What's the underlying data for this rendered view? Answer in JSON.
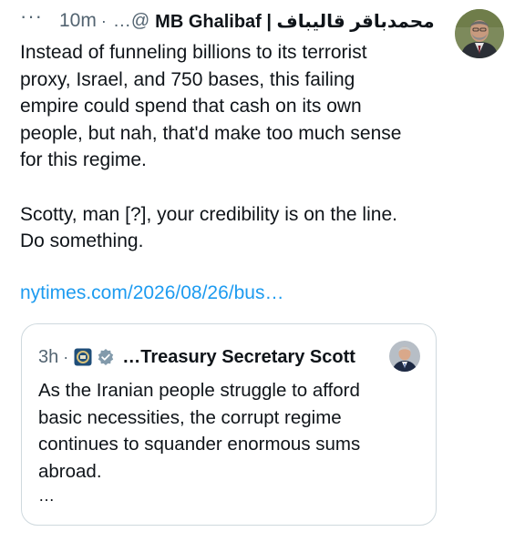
{
  "tweet": {
    "more_label": "···",
    "time": "10m",
    "separator": "·",
    "handle": "…@",
    "display_name": "MB Ghalibaf | محمدباقر قالیباف",
    "body_lines": [
      "Instead of funneling billions to its terrorist",
      "proxy, Israel, and 750 bases, this failing",
      "empire could spend that cash on its own",
      "people, but nah, that'd make too much sense",
      "for this regime."
    ],
    "body_lines_2": [
      "Scotty, man [?], your credibility is on the line.",
      "Do something."
    ],
    "link": "nytimes.com/2026/08/26/bus…"
  },
  "quote": {
    "time": "3h",
    "separator": "·",
    "display_name": "…Treasury Secretary Scott",
    "body_lines": [
      "As the Iranian people struggle to afford",
      "basic necessities, the corrupt regime",
      "continues to squander enormous sums",
      "abroad."
    ],
    "ellipsis": "…"
  },
  "icons": {
    "verified_badge": "verified-badge-icon",
    "treasury_seal": "treasury-seal-icon",
    "more": "more-options-icon"
  },
  "colors": {
    "text": "#0f1419",
    "secondary": "#536471",
    "link": "#1d9bf0",
    "border": "#cfd9de",
    "government_badge": "#829aab"
  }
}
